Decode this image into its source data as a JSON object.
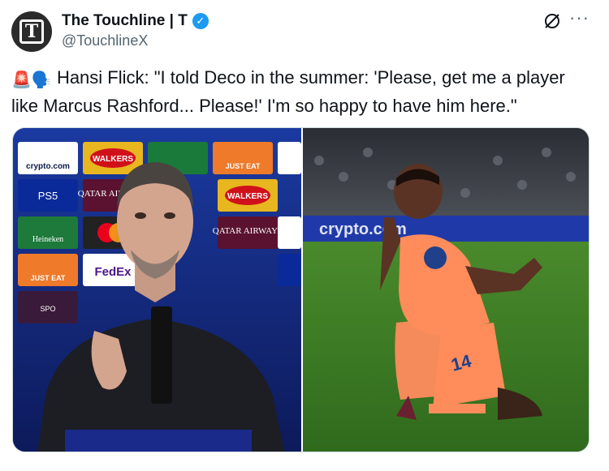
{
  "tweet": {
    "display_name": "The Touchline | T",
    "handle": "@TouchlineX",
    "text_emojis": "🚨🗣️",
    "text": "Hansi Flick: \"I told Deco in the summer: 'Please, get me a player like Marcus Rashford... Please!' I'm so happy to have him here.\"",
    "avatar_letter": "T",
    "more_label": "···"
  },
  "icons": {
    "verified": "verified-badge-icon",
    "grok": "grok-icon",
    "more": "more-icon"
  },
  "media": {
    "left": {
      "sponsors": [
        "crypto.com",
        "WALKERS",
        "JUST EAT",
        "PS5",
        "QATAR AIRWAYS",
        "WALKERS",
        "Heineken",
        "QATAR AIRWAYS",
        "JUST EAT",
        "FedEx",
        "SPO"
      ]
    },
    "right": {
      "jersey_number": "14",
      "ad_board": "crypto.com"
    }
  },
  "colors": {
    "verified": "#1d9bf0",
    "handle": "#536471",
    "jersey": "#ff8a5c",
    "ucl_blue": "#14267a"
  }
}
